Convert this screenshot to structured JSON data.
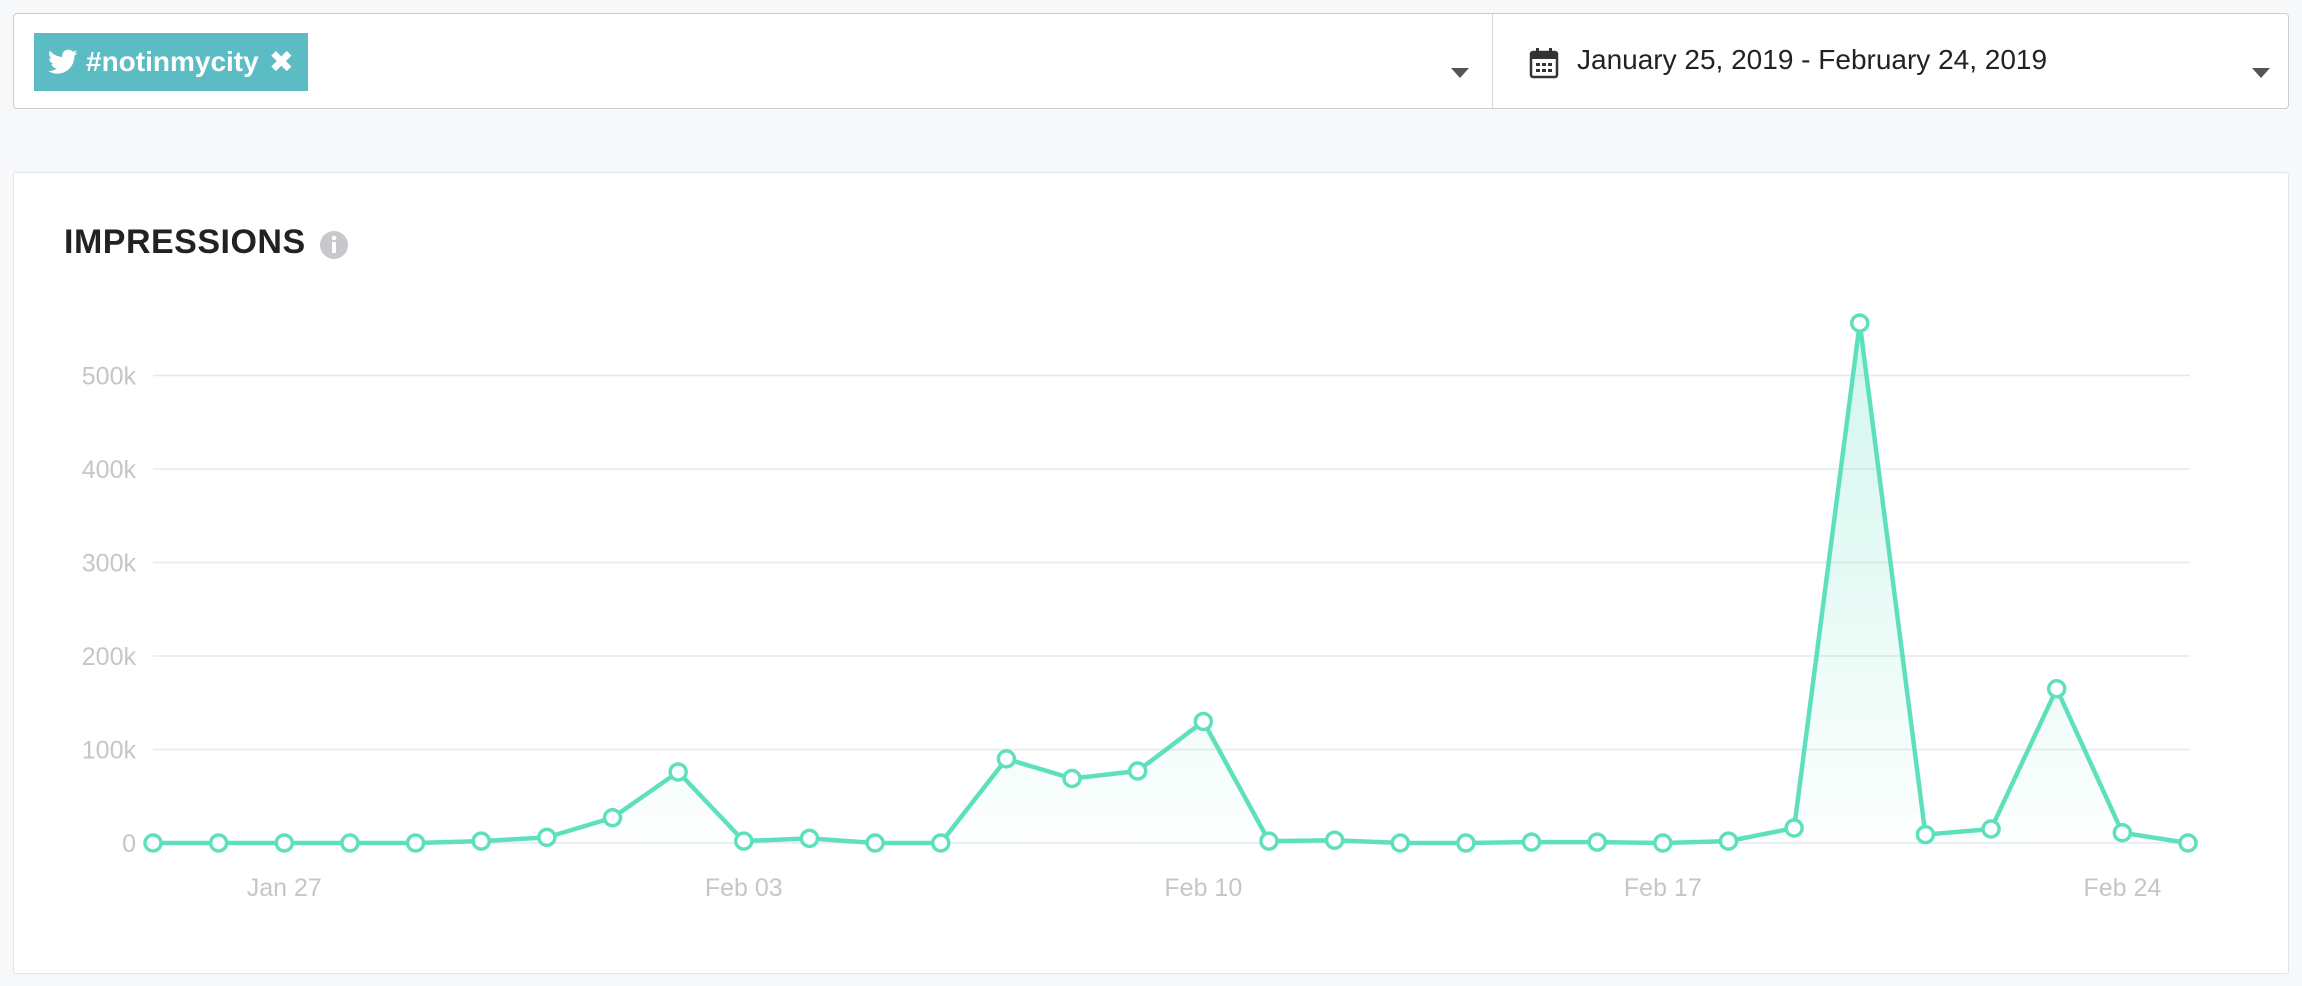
{
  "filter": {
    "hashtag": "#notinmycity",
    "date_range": "January 25, 2019 - February 24, 2019",
    "hashtag_icon": "twitter-icon",
    "remove_icon": "close-icon",
    "calendar_icon": "calendar-icon",
    "dropdown_icon": "caret-down-icon"
  },
  "card": {
    "title": "IMPRESSIONS",
    "info_icon": "info-icon"
  },
  "colors": {
    "accent": "#5fe0bc",
    "chip": "#5cbcc4"
  },
  "chart_data": {
    "type": "area",
    "title": "IMPRESSIONS",
    "xlabel": "",
    "ylabel": "",
    "ylim": [
      0,
      550000
    ],
    "yticks": [
      0,
      100000,
      200000,
      300000,
      400000,
      500000
    ],
    "ytick_labels": [
      "0",
      "100k",
      "200k",
      "300k",
      "400k",
      "500k"
    ],
    "xtick_labels": [
      "Jan 27",
      "Feb 03",
      "Feb 10",
      "Feb 17",
      "Feb 24"
    ],
    "grid": true,
    "x": [
      "Jan 25",
      "Jan 26",
      "Jan 27",
      "Jan 28",
      "Jan 29",
      "Jan 30",
      "Jan 31",
      "Feb 01",
      "Feb 02",
      "Feb 03",
      "Feb 04",
      "Feb 05",
      "Feb 06",
      "Feb 07",
      "Feb 08",
      "Feb 09",
      "Feb 10",
      "Feb 11",
      "Feb 12",
      "Feb 13",
      "Feb 14",
      "Feb 15",
      "Feb 16",
      "Feb 17",
      "Feb 18",
      "Feb 19",
      "Feb 20",
      "Feb 21",
      "Feb 22",
      "Feb 23",
      "Feb 24",
      "Feb 25"
    ],
    "series": [
      {
        "values": [
          0,
          0,
          0,
          0,
          0,
          2000,
          6000,
          27000,
          76000,
          2000,
          5000,
          0,
          0,
          90000,
          69000,
          77000,
          130000,
          2000,
          3000,
          0,
          0,
          1000,
          1000,
          0,
          2000,
          16000,
          556000,
          9000,
          15000,
          165000,
          11000,
          0
        ]
      }
    ]
  }
}
